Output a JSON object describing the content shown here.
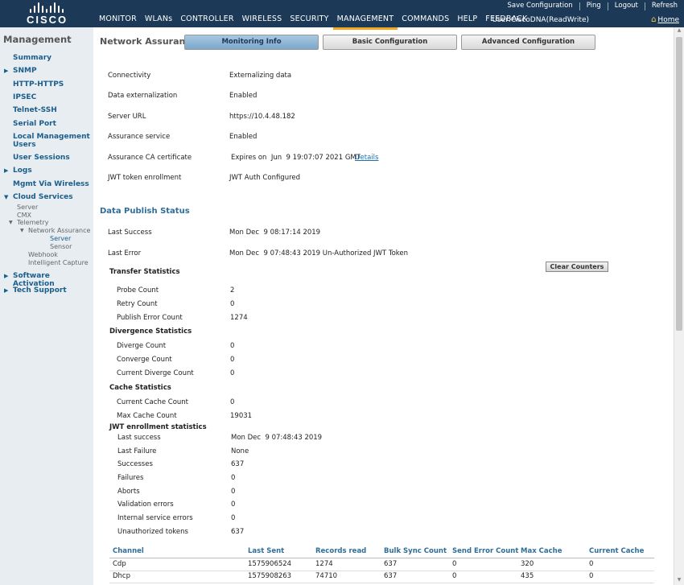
{
  "brand": {
    "name": "CISCO"
  },
  "top_links": {
    "save": "Save Configuration",
    "ping": "Ping",
    "logout": "Logout",
    "refresh": "Refresh"
  },
  "user": "User:CiscoDNA(ReadWrite)",
  "home": "Home",
  "menu": [
    "MONITOR",
    "WLANs",
    "CONTROLLER",
    "WIRELESS",
    "SECURITY",
    "MANAGEMENT",
    "COMMANDS",
    "HELP",
    "FEEDBACK"
  ],
  "sidebar": {
    "title": "Management",
    "items": [
      "Summary",
      "SNMP",
      "HTTP-HTTPS",
      "IPSEC",
      "Telnet-SSH",
      "Serial Port",
      "Local Management Users",
      "User Sessions",
      "Logs",
      "Mgmt Via Wireless",
      "Cloud Services",
      "Software Activation",
      "Tech Support"
    ],
    "cloud_sub": [
      "Server",
      "CMX",
      "Telemetry",
      "Network Assurance",
      "Server",
      "Sensor",
      "Webhook",
      "Intelligent Capture"
    ]
  },
  "page": {
    "title": "Network Assurance",
    "tabs": [
      "Monitoring Info",
      "Basic Configuration",
      "Advanced Configuration"
    ]
  },
  "info": [
    {
      "label": "Connectivity",
      "value": "Externalizing data"
    },
    {
      "label": "Data externalization",
      "value": "Enabled"
    },
    {
      "label": "Server URL",
      "value": "https://10.4.48.182"
    },
    {
      "label": "Assurance service",
      "value": "Enabled"
    },
    {
      "label": "Assurance CA certificate",
      "value": "Expires on  Jun  9 19:07:07 2021 GMT",
      "link": "Details"
    },
    {
      "label": "JWT token enrollment",
      "value": "JWT Auth Configured"
    }
  ],
  "publish": {
    "heading": "Data Publish Status",
    "last_success_label": "Last Success",
    "last_success": "Mon Dec  9 08:17:14 2019",
    "last_error_label": "Last Error",
    "last_error": "Mon Dec  9 07:48:43 2019 Un-Authorized JWT Token",
    "clear_button": "Clear Counters"
  },
  "transfer": {
    "heading": "Transfer Statistics",
    "rows": [
      {
        "label": "Probe Count",
        "value": "2"
      },
      {
        "label": "Retry Count",
        "value": "0"
      },
      {
        "label": "Publish Error Count",
        "value": "1274"
      }
    ]
  },
  "divergence": {
    "heading": "Divergence Statistics",
    "rows": [
      {
        "label": "Diverge Count",
        "value": "0"
      },
      {
        "label": "Converge Count",
        "value": "0"
      },
      {
        "label": "Current Diverge Count",
        "value": "0"
      }
    ]
  },
  "cache": {
    "heading": "Cache Statistics",
    "rows": [
      {
        "label": "Current Cache Count",
        "value": "0"
      },
      {
        "label": "Max Cache Count",
        "value": "19031"
      }
    ]
  },
  "jwt": {
    "heading": "JWT enrollment statistics",
    "rows": [
      {
        "label": "Last success",
        "value": "Mon Dec  9 07:48:43 2019"
      },
      {
        "label": "Last Failure",
        "value": "None"
      },
      {
        "label": "Successes",
        "value": "637"
      },
      {
        "label": "Failures",
        "value": "0"
      },
      {
        "label": "Aborts",
        "value": "0"
      },
      {
        "label": "Validation errors",
        "value": "0"
      },
      {
        "label": "Internal service errors",
        "value": "0"
      },
      {
        "label": "Unauthorized tokens",
        "value": "637"
      }
    ]
  },
  "table": {
    "columns": [
      "Channel",
      "Last Sent",
      "Records read",
      "Bulk Sync Count",
      "Send Error Count",
      "Max Cache",
      "Current Cache"
    ],
    "rows": [
      [
        "Cdp",
        "1575906524",
        "1274",
        "637",
        "0",
        "320",
        "0"
      ],
      [
        "Dhcp",
        "1575908263",
        "74710",
        "637",
        "0",
        "435",
        "0"
      ]
    ]
  }
}
